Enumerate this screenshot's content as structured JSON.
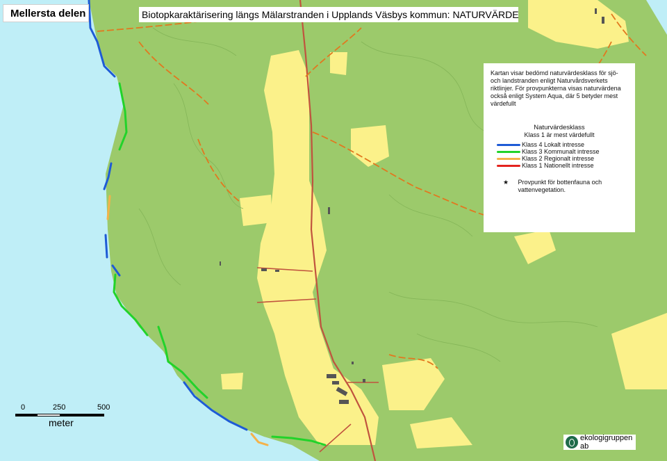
{
  "header": {
    "part_label": "Mellersta delen",
    "title": "Biotopkaraktärisering längs Mälarstranden i Upplands Väsbys kommun: NATURVÄRDE"
  },
  "legend": {
    "description": "Kartan visar bedömd naturvärdesklass för sjö-och landstranden enligt Naturvårdsverkets riktlinjer. För provpunkterna visas naturvärdena också enligt System Aqua, där 5 betyder mest värdefullt",
    "heading": "Naturvärdesklass",
    "subheading": "Klass 1 är mest värdefullt",
    "classes": [
      {
        "label": "Klass 4 Lokalt intresse",
        "color": "#1e5bd6"
      },
      {
        "label": "Klass 3 Kommunalt intresse",
        "color": "#22d32a"
      },
      {
        "label": "Klass 2 Regionalt intresse",
        "color": "#f4b24a"
      },
      {
        "label": "Klass 1 Nationellt intresse",
        "color": "#e3231e"
      }
    ],
    "point_symbol": "★",
    "point_label": "Provpunkt för bottenfauna och vattenvegetation."
  },
  "scalebar": {
    "ticks": [
      "0",
      "250",
      "500"
    ],
    "unit": "meter"
  },
  "logo": {
    "text": "ekologigruppen ab"
  },
  "map_colors": {
    "water": "#bfeef7",
    "forest": "#9cca6b",
    "open_land": "#fbf18a",
    "road": "#c0533e",
    "path": "#e1781f",
    "building": "#555555"
  }
}
